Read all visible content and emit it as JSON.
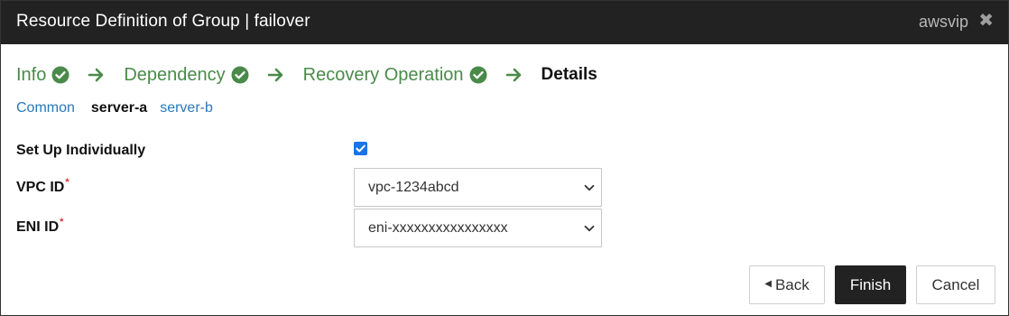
{
  "titlebar": {
    "title": "Resource Definition of Group | failover",
    "resource_name": "awsvip",
    "close_icon": "close-icon"
  },
  "steps": [
    {
      "label": "Info",
      "state": "done"
    },
    {
      "label": "Dependency",
      "state": "done"
    },
    {
      "label": "Recovery Operation",
      "state": "done"
    },
    {
      "label": "Details",
      "state": "current"
    }
  ],
  "tabs": {
    "common": "Common",
    "server_a": "server-a",
    "server_b": "server-b"
  },
  "form": {
    "setup_individually_label": "Set Up Individually",
    "setup_individually_checked": true,
    "vpc_label": "VPC ID",
    "vpc_value": "vpc-1234abcd",
    "eni_label": "ENI ID",
    "eni_value": "eni-xxxxxxxxxxxxxxxx",
    "required_mark": "*"
  },
  "buttons": {
    "back": "Back",
    "finish": "Finish",
    "cancel": "Cancel"
  },
  "colors": {
    "titlebar": "#222222",
    "step_done": "#4a8a4a",
    "link": "#2a78b8",
    "checkbox": "#1a73e8",
    "required": "#dd3333"
  }
}
